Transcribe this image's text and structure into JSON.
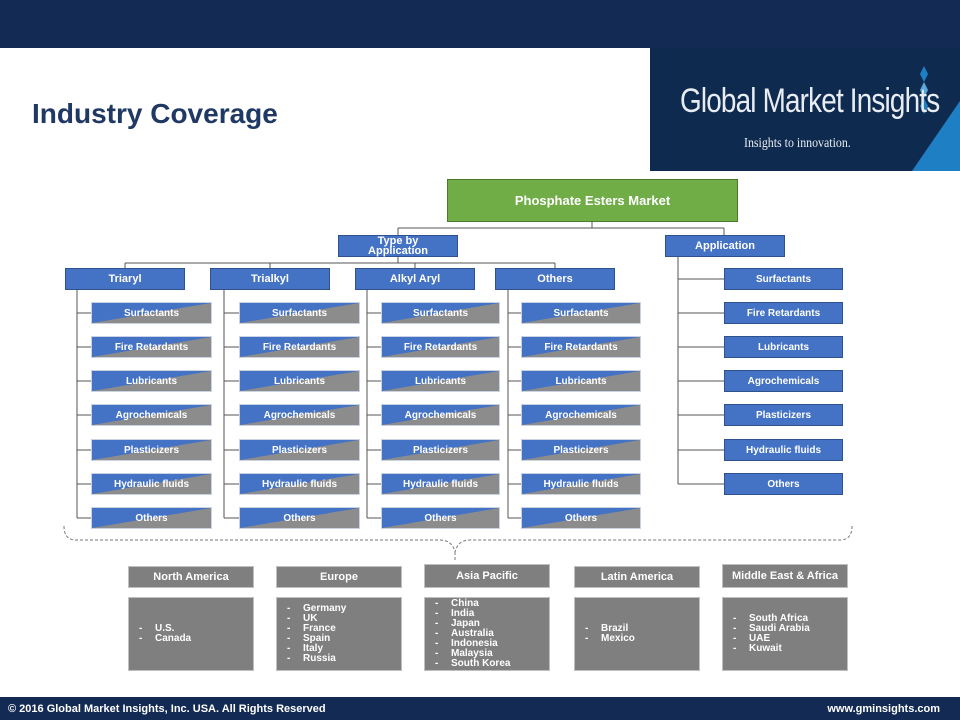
{
  "header": {
    "title": "Industry Coverage",
    "logo_name": "Global Market Insights",
    "logo_tagline": "Insights to innovation."
  },
  "diagram": {
    "root": "Phosphate Esters Market",
    "branches": [
      {
        "label": "Type by Application",
        "types": [
          {
            "label": "Triaryl",
            "items": [
              "Surfactants",
              "Fire Retardants",
              "Lubricants",
              "Agrochemicals",
              "Plasticizers",
              "Hydraulic fluids",
              "Others"
            ]
          },
          {
            "label": "Trialkyl",
            "items": [
              "Surfactants",
              "Fire Retardants",
              "Lubricants",
              "Agrochemicals",
              "Plasticizers",
              "Hydraulic fluids",
              "Others"
            ]
          },
          {
            "label": "Alkyl Aryl",
            "items": [
              "Surfactants",
              "Fire Retardants",
              "Lubricants",
              "Agrochemicals",
              "Plasticizers",
              "Hydraulic fluids",
              "Others"
            ]
          },
          {
            "label": "Others",
            "items": [
              "Surfactants",
              "Fire Retardants",
              "Lubricants",
              "Agrochemicals",
              "Plasticizers",
              "Hydraulic fluids",
              "Others"
            ]
          }
        ]
      },
      {
        "label": "Application",
        "items": [
          "Surfactants",
          "Fire Retardants",
          "Lubricants",
          "Agrochemicals",
          "Plasticizers",
          "Hydraulic fluids",
          "Others"
        ]
      }
    ],
    "regions": [
      {
        "name": "North America",
        "countries": [
          "U.S.",
          "Canada"
        ]
      },
      {
        "name": "Europe",
        "countries": [
          "Germany",
          "UK",
          "France",
          "Spain",
          "Italy",
          "Russia"
        ]
      },
      {
        "name": "Asia Pacific",
        "countries": [
          "China",
          "India",
          "Japan",
          "Australia",
          "Indonesia",
          "Malaysia",
          "South Korea"
        ]
      },
      {
        "name": "Latin America",
        "countries": [
          "Brazil",
          "Mexico"
        ]
      },
      {
        "name": "Middle East & Africa",
        "countries": [
          "South Africa",
          "Saudi Arabia",
          "UAE",
          "Kuwait"
        ]
      }
    ]
  },
  "footer": {
    "copyright": "© 2016 Global Market Insights, Inc. USA.  All Rights Reserved",
    "website": "www.gminsights.com"
  },
  "colors": {
    "navy": "#132a54",
    "title": "#1f3864",
    "green": "#70ad47",
    "blue": "#4472c4",
    "gray": "#7f7f7f"
  }
}
